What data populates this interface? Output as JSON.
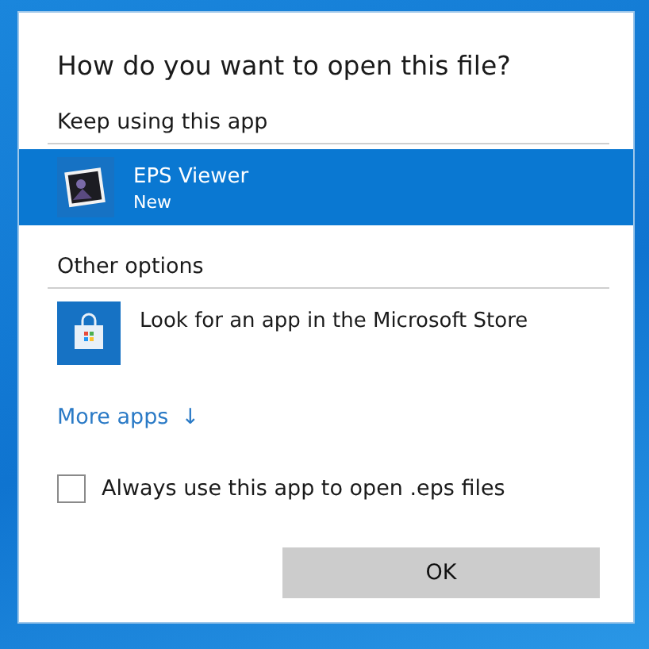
{
  "dialog": {
    "title": "How do you want to open this file?"
  },
  "keep_using": {
    "label": "Keep using this app",
    "apps": [
      {
        "kind": "viewer",
        "name": "EPS Viewer",
        "subtitle": "New",
        "selected": true
      }
    ]
  },
  "other_options": {
    "label": "Other options",
    "apps": [
      {
        "kind": "store",
        "name": "Look for an app in the Microsoft Store",
        "selected": false
      }
    ]
  },
  "more_apps": {
    "label": "More apps",
    "icon": "↓"
  },
  "always_use": {
    "label": "Always use this app to open .eps files",
    "checked": false
  },
  "buttons": [
    {
      "label": "OK"
    }
  ]
}
